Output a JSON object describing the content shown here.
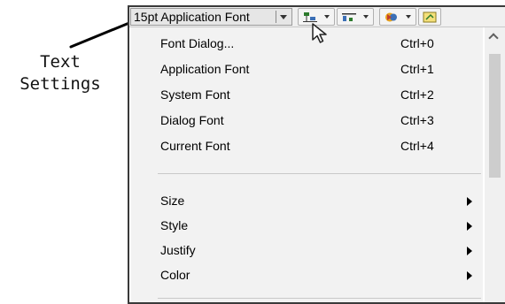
{
  "callout": {
    "line1": "Text",
    "line2": "Settings"
  },
  "toolbar": {
    "font_select_value": "15pt Application Font",
    "buttons": [
      {
        "icon": "align-objects-icon"
      },
      {
        "icon": "distribute-objects-icon"
      },
      {
        "icon": "reorder-icon"
      },
      {
        "icon": "cleanup-diagram-icon"
      }
    ]
  },
  "menu": {
    "items": [
      {
        "label": "Font Dialog...",
        "shortcut": "Ctrl+0"
      },
      {
        "label": "Application Font",
        "shortcut": "Ctrl+1"
      },
      {
        "label": "System Font",
        "shortcut": "Ctrl+2"
      },
      {
        "label": "Dialog Font",
        "shortcut": "Ctrl+3"
      },
      {
        "label": "Current Font",
        "shortcut": "Ctrl+4"
      }
    ],
    "submenus": [
      {
        "label": "Size"
      },
      {
        "label": "Style"
      },
      {
        "label": "Justify"
      },
      {
        "label": "Color"
      }
    ]
  },
  "colors": {
    "menu_bg": "#f2f2f2",
    "toolbar_bg": "#f0f0f0",
    "border": "#3a3a3a"
  }
}
